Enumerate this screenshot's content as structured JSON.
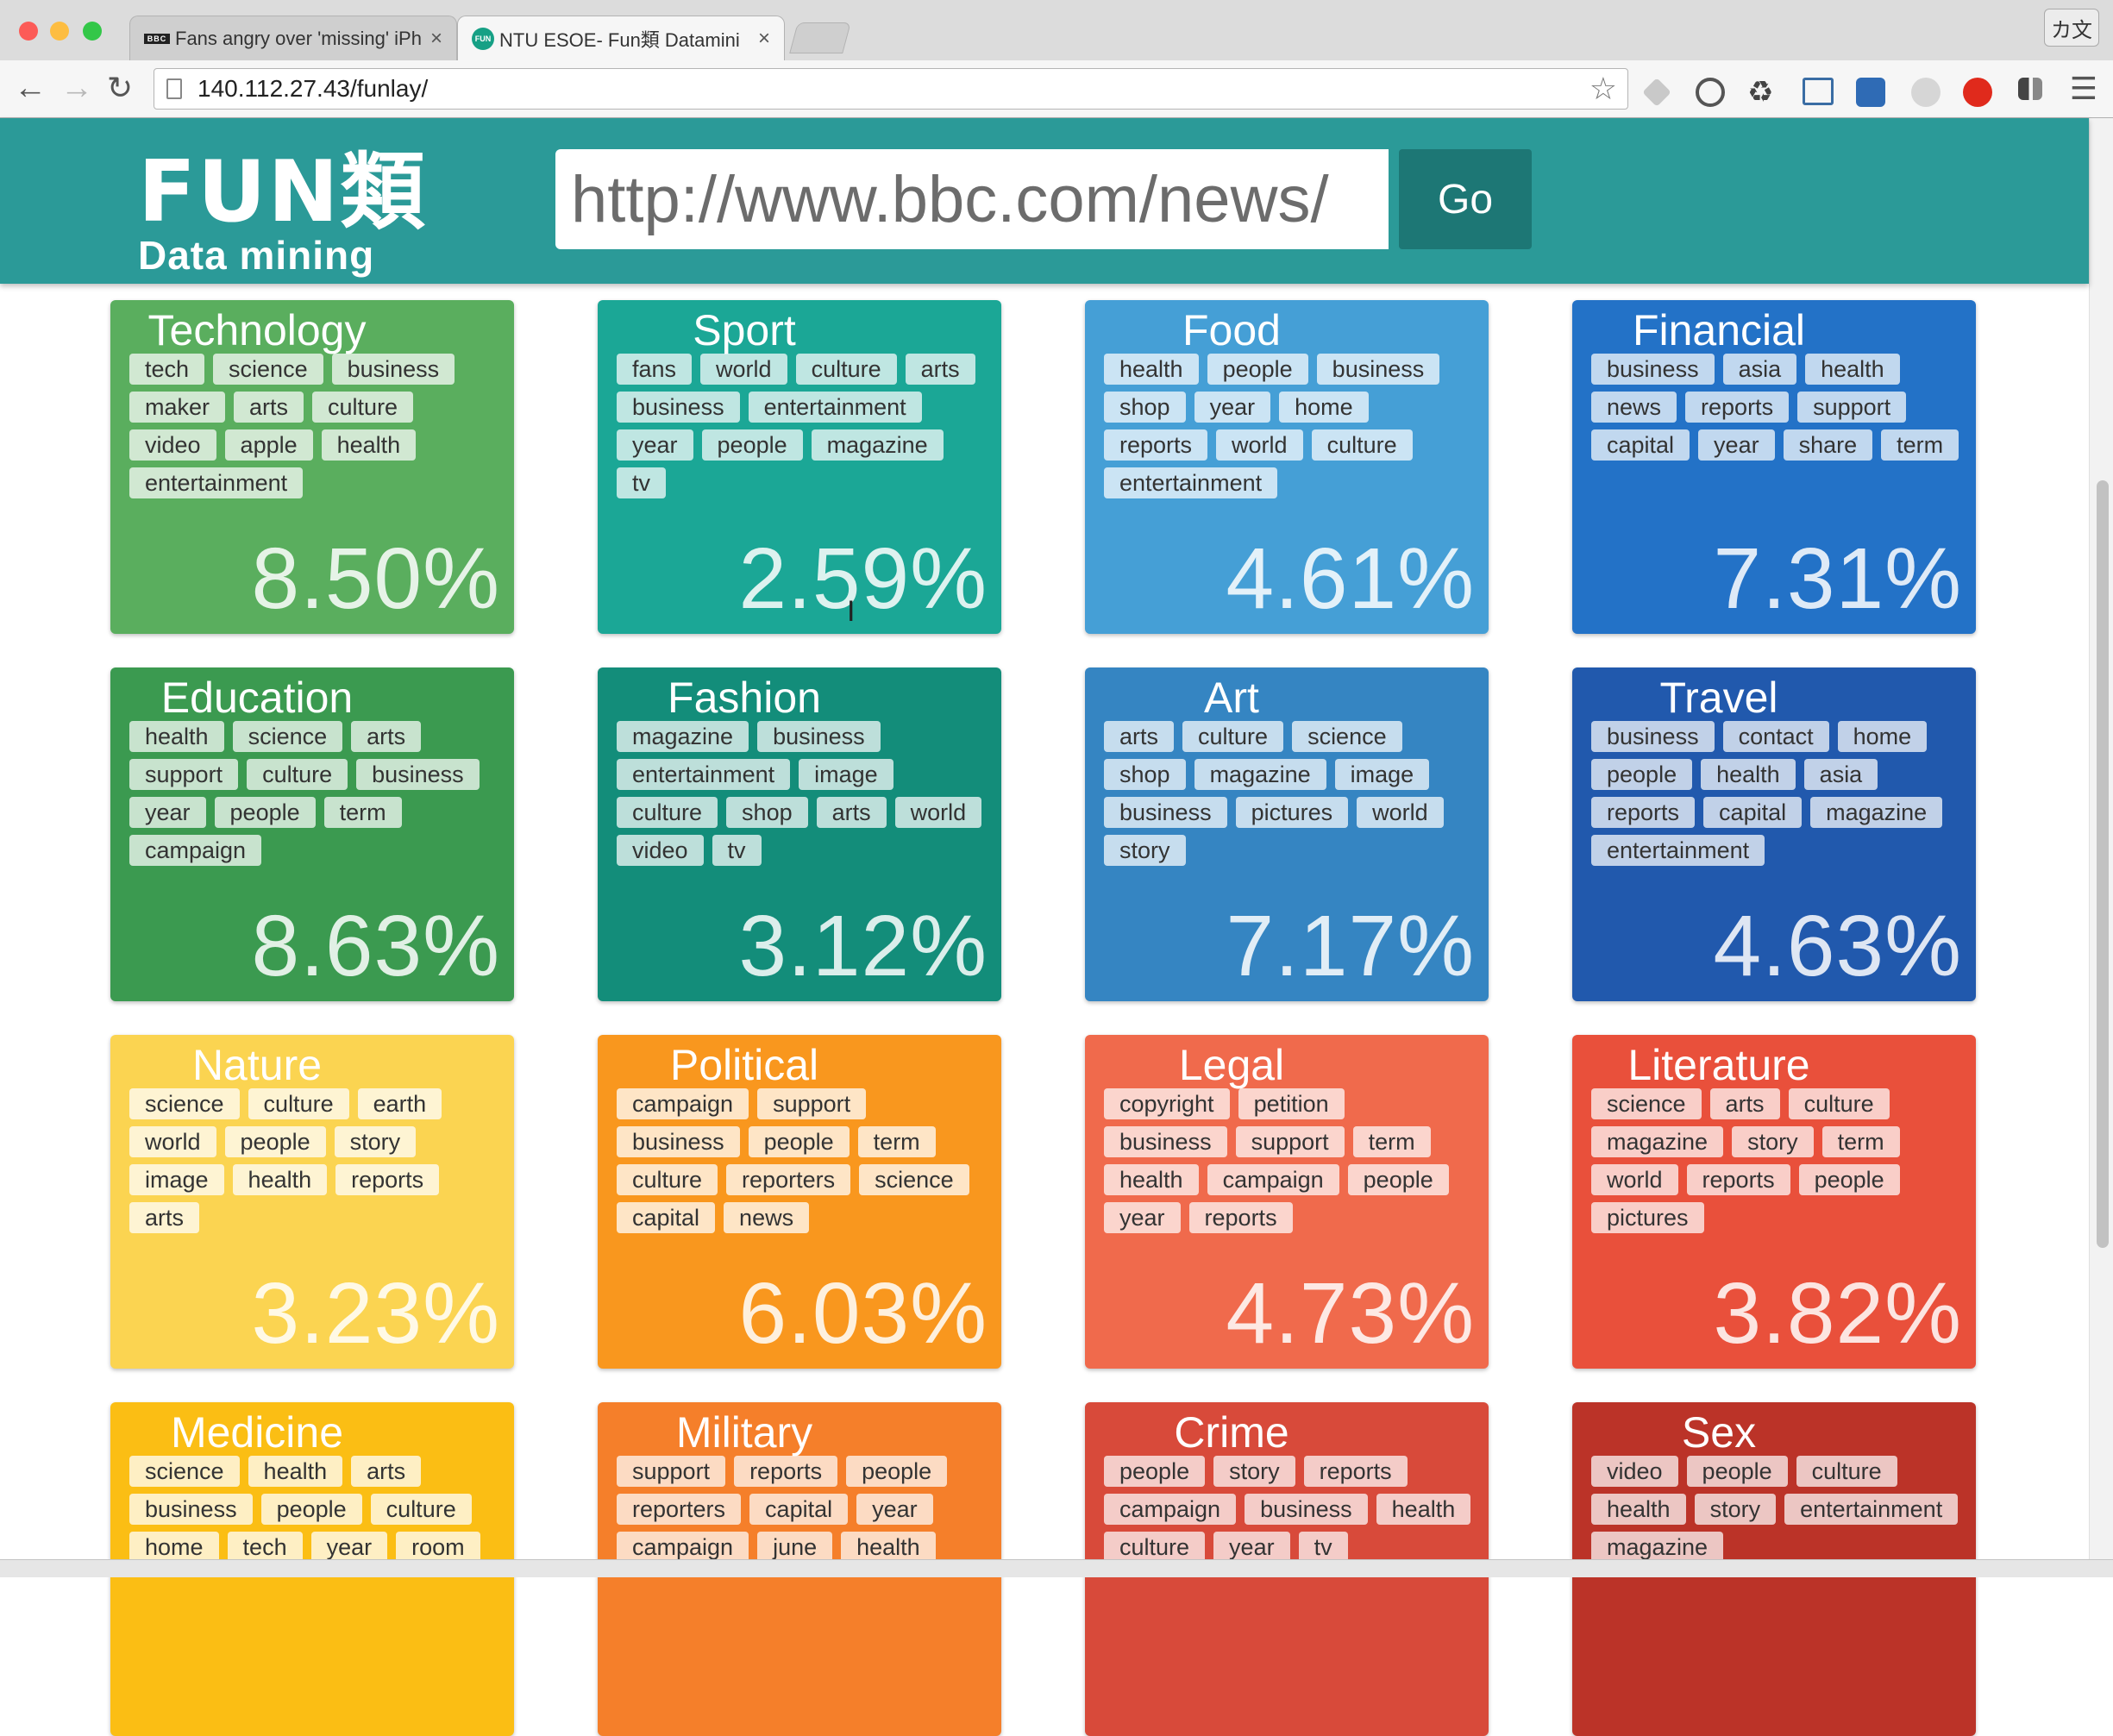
{
  "browser": {
    "tabs": [
      {
        "favicon": "BBC",
        "title": "Fans angry over 'missing' iPh"
      },
      {
        "favicon": "FUN",
        "title": "NTU ESOE- Fun類 Datamini"
      }
    ],
    "ime_label": "カ文",
    "address": "140.112.27.43/funlay/"
  },
  "header": {
    "logo_main": "FUN類",
    "logo_sub": "Data mining",
    "url_value": "http://www.bbc.com/news/",
    "go_label": "Go"
  },
  "categories": [
    {
      "title": "Technology",
      "color": "#5aae5e",
      "tags": [
        "tech",
        "science",
        "business",
        "maker",
        "arts",
        "culture",
        "video",
        "apple",
        "health",
        "entertainment"
      ],
      "percent": "8.50%"
    },
    {
      "title": "Sport",
      "color": "#1ba796",
      "tags": [
        "fans",
        "world",
        "culture",
        "arts",
        "business",
        "entertainment",
        "year",
        "people",
        "magazine",
        "tv"
      ],
      "percent": "2.59%"
    },
    {
      "title": "Food",
      "color": "#459fd6",
      "tags": [
        "health",
        "people",
        "business",
        "shop",
        "year",
        "home",
        "reports",
        "world",
        "culture",
        "entertainment"
      ],
      "percent": "4.61%"
    },
    {
      "title": "Financial",
      "color": "#2372c7",
      "tags": [
        "business",
        "asia",
        "health",
        "news",
        "reports",
        "support",
        "capital",
        "year",
        "share",
        "term"
      ],
      "percent": "7.31%"
    },
    {
      "title": "Education",
      "color": "#3b9a50",
      "tags": [
        "health",
        "science",
        "arts",
        "support",
        "culture",
        "business",
        "year",
        "people",
        "term",
        "campaign"
      ],
      "percent": "8.63%"
    },
    {
      "title": "Fashion",
      "color": "#138d7a",
      "tags": [
        "magazine",
        "business",
        "entertainment",
        "image",
        "culture",
        "shop",
        "arts",
        "world",
        "video",
        "tv"
      ],
      "percent": "3.12%"
    },
    {
      "title": "Art",
      "color": "#3585c2",
      "tags": [
        "arts",
        "culture",
        "science",
        "shop",
        "magazine",
        "image",
        "business",
        "pictures",
        "world",
        "story"
      ],
      "percent": "7.17%"
    },
    {
      "title": "Travel",
      "color": "#2159ad",
      "tags": [
        "business",
        "contact",
        "home",
        "people",
        "health",
        "asia",
        "reports",
        "capital",
        "magazine",
        "entertainment"
      ],
      "percent": "4.63%"
    },
    {
      "title": "Nature",
      "color": "#fbd451",
      "tags": [
        "science",
        "culture",
        "earth",
        "world",
        "people",
        "story",
        "image",
        "health",
        "reports",
        "arts"
      ],
      "percent": "3.23%"
    },
    {
      "title": "Political",
      "color": "#f9971e",
      "tags": [
        "campaign",
        "support",
        "business",
        "people",
        "term",
        "culture",
        "reporters",
        "science",
        "capital",
        "news"
      ],
      "percent": "6.03%"
    },
    {
      "title": "Legal",
      "color": "#f06a4c",
      "tags": [
        "copyright",
        "petition",
        "business",
        "support",
        "term",
        "health",
        "campaign",
        "people",
        "year",
        "reports"
      ],
      "percent": "4.73%"
    },
    {
      "title": "Literature",
      "color": "#e9503b",
      "tags": [
        "science",
        "arts",
        "culture",
        "magazine",
        "story",
        "term",
        "world",
        "reports",
        "people",
        "pictures"
      ],
      "percent": "3.82%"
    },
    {
      "title": "Medicine",
      "color": "#fbbe14",
      "tags": [
        "science",
        "health",
        "arts",
        "business",
        "people",
        "culture",
        "home",
        "tech",
        "year",
        "room"
      ],
      "percent": ""
    },
    {
      "title": "Military",
      "color": "#f57f2a",
      "tags": [
        "support",
        "reports",
        "people",
        "reporters",
        "capital",
        "year",
        "campaign",
        "june",
        "health"
      ],
      "percent": ""
    },
    {
      "title": "Crime",
      "color": "#d84a3a",
      "tags": [
        "people",
        "story",
        "reports",
        "campaign",
        "business",
        "health",
        "culture",
        "year",
        "tv"
      ],
      "percent": ""
    },
    {
      "title": "Sex",
      "color": "#bb3328",
      "tags": [
        "video",
        "people",
        "culture",
        "health",
        "story",
        "entertainment",
        "magazine"
      ],
      "percent": ""
    }
  ]
}
